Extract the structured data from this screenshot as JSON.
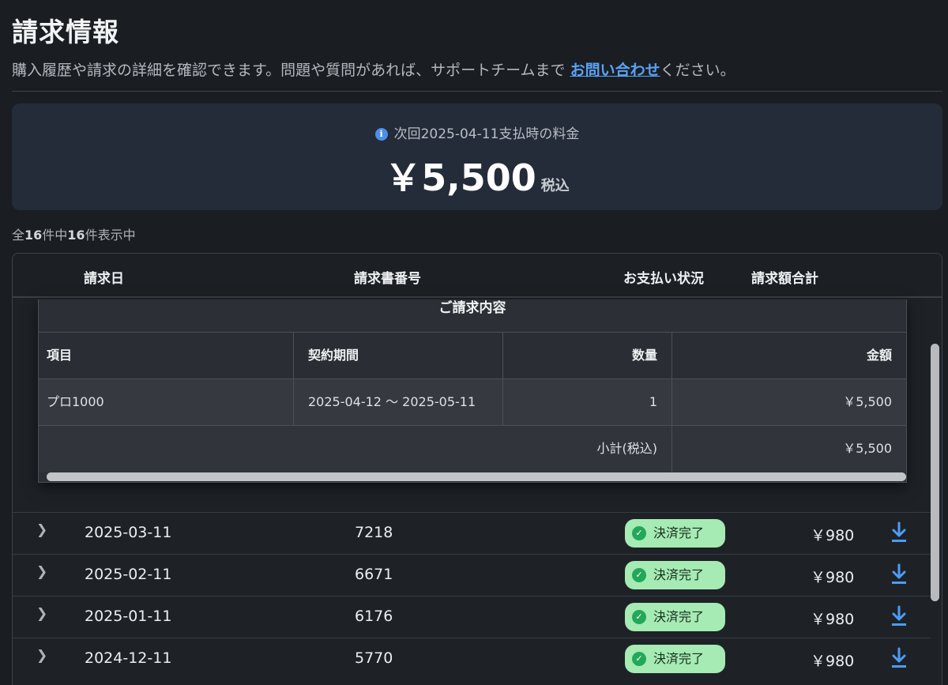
{
  "header": {
    "title": "請求情報",
    "description_prefix": "購入履歴や請求の詳細を確認できます。問題や質問があれば、サポートチームまで ",
    "contact_link": "お問い合わせ",
    "description_suffix": "ください。"
  },
  "next_payment": {
    "label": "次回2025-04-11支払時の料金",
    "amount": "￥5,500",
    "tax_label": "税込",
    "info_icon": "info-icon"
  },
  "summary": {
    "prefix": "全",
    "total": "16",
    "middle": "件中",
    "shown": "16",
    "suffix": "件表示中"
  },
  "table": {
    "columns": {
      "date": "請求日",
      "invoice_number": "請求書番号",
      "status": "お支払い状況",
      "total": "請求額合計"
    },
    "detail": {
      "caption": "ご請求内容",
      "headers": [
        "項目",
        "契約期間",
        "数量",
        "金額"
      ],
      "item": {
        "name": "プロ1000",
        "period": "2025-04-12 〜 2025-05-11",
        "quantity": "1",
        "amount": "￥5,500"
      },
      "subtotal_label": "小計(税込)",
      "subtotal_amount": "￥5,500"
    },
    "rows": [
      {
        "date": "2025-03-11",
        "number": "7218",
        "status": "決済完了",
        "amount": "￥980"
      },
      {
        "date": "2025-02-11",
        "number": "6671",
        "status": "決済完了",
        "amount": "￥980"
      },
      {
        "date": "2025-01-11",
        "number": "6176",
        "status": "決済完了",
        "amount": "￥980"
      },
      {
        "date": "2024-12-11",
        "number": "5770",
        "status": "決済完了",
        "amount": "￥980"
      }
    ]
  },
  "colors": {
    "background": "#1a1e23",
    "accent_link": "#5aa2f5",
    "status_badge": "#a6eab4",
    "download_icon": "#4c9cf5"
  }
}
